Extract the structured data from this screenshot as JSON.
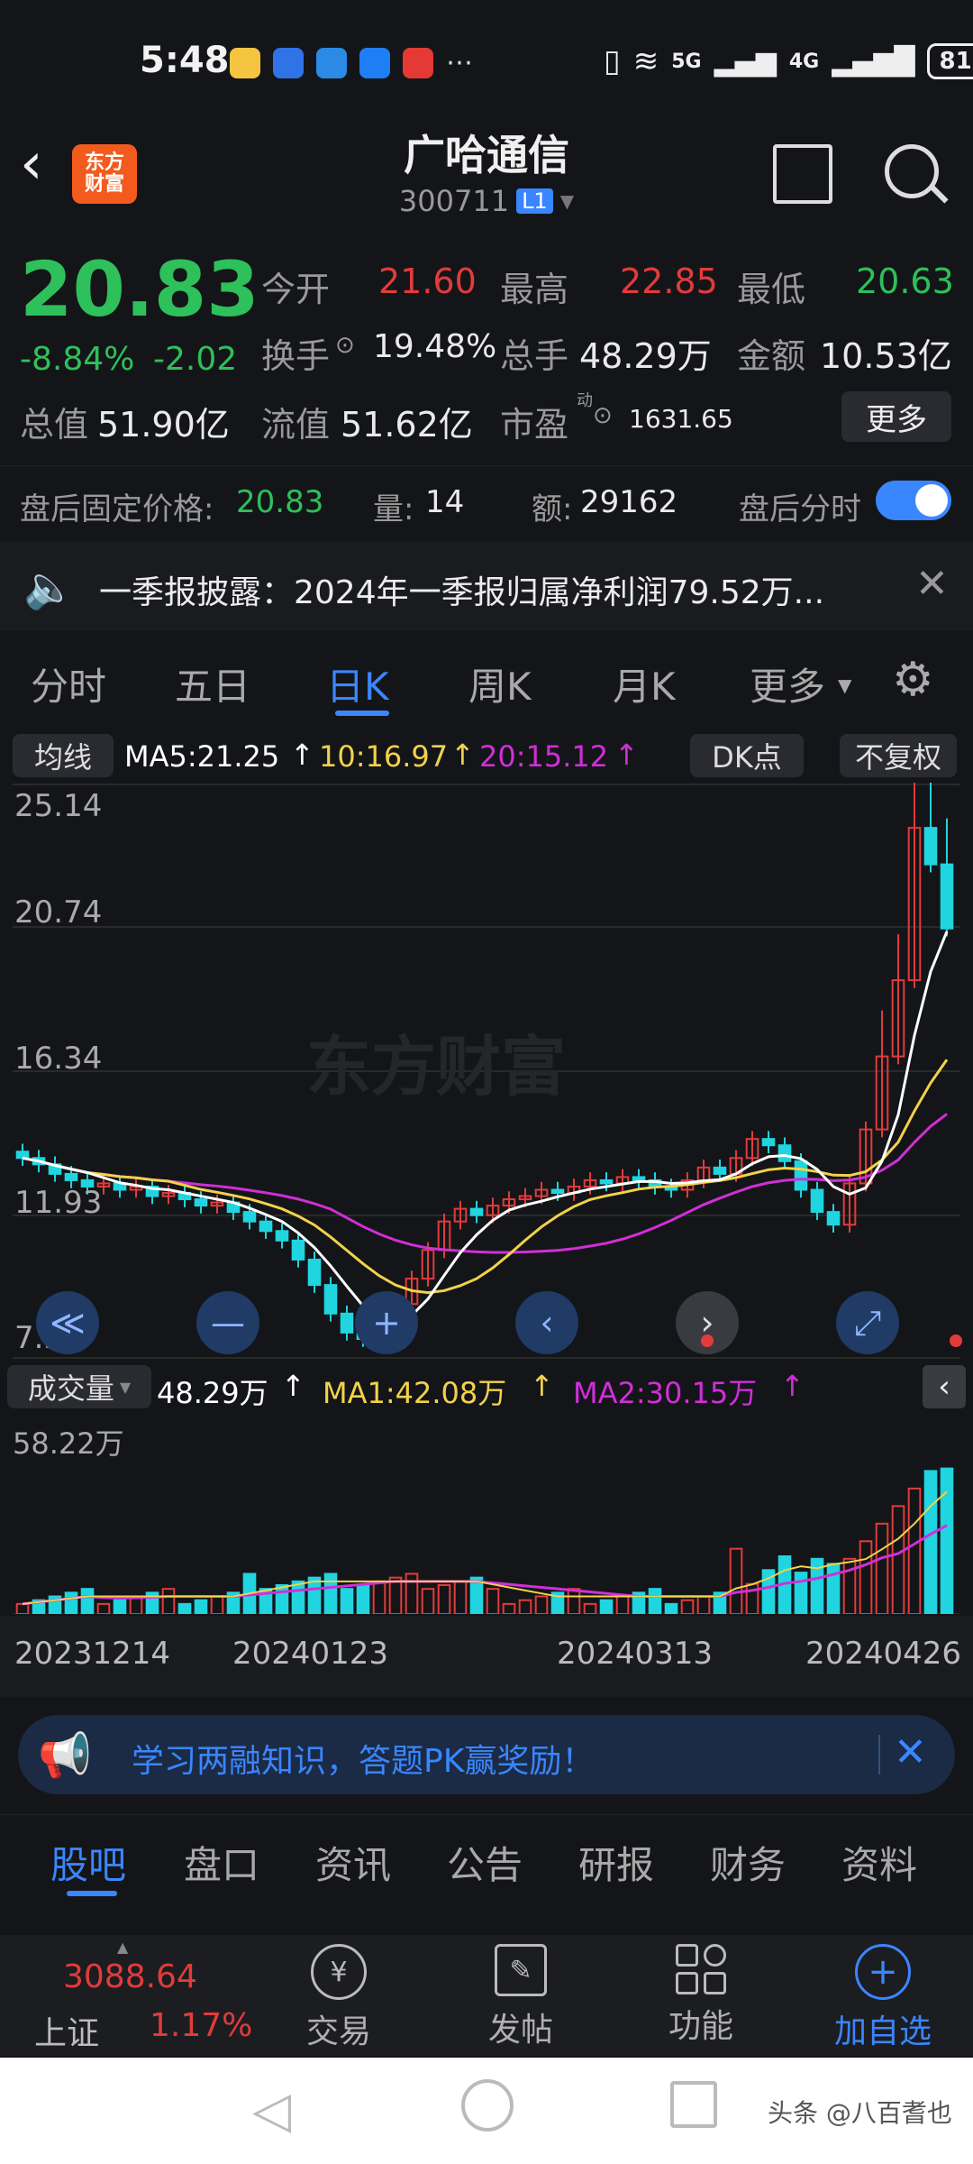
{
  "status": {
    "time": "5:48",
    "icons": [
      "weibo-icon",
      "blue-app-icon",
      "blue-app2-icon",
      "alipay-icon",
      "red-app-icon",
      "more-dots-icon"
    ],
    "signal_text": "5G",
    "signal_text2": "4G",
    "battery": "81"
  },
  "header": {
    "logo_text_line1": "东方",
    "logo_text_line2": "财富",
    "stock_name": "广哈通信",
    "stock_code": "300711",
    "level_badge": "L1"
  },
  "quote": {
    "price": "20.83",
    "pct": "-8.84%",
    "chg": "-2.02",
    "open_label": "今开",
    "open": "21.60",
    "high_label": "最高",
    "high": "22.85",
    "low_label": "最低",
    "low": "20.63",
    "turnover_label": "换手",
    "turnover": "19.48%",
    "volume_label": "总手",
    "volume": "48.29万",
    "amount_label": "金额",
    "amount": "10.53亿",
    "mkt_cap_label": "总值",
    "mkt_cap": "51.90亿",
    "float_cap_label": "流值",
    "float_cap": "51.62亿",
    "pe_label": "市盈",
    "pe_sup": "动",
    "pe": "1631.65",
    "more_label": "更多"
  },
  "afterhours": {
    "price_label": "盘后固定价格:",
    "price": "20.83",
    "vol_label": "量:",
    "vol": "14",
    "amt_label": "额:",
    "amt": "29162",
    "toggle_label": "盘后分时"
  },
  "notice": {
    "text": "一季报披露：2024年一季报归属净利润79.52万..."
  },
  "chart_tabs": [
    "分时",
    "五日",
    "日K",
    "周K",
    "月K",
    "更多"
  ],
  "chart_tabs_active": 2,
  "ma_bar": {
    "label": "均线",
    "ma5": "MA5:21.25",
    "ma10": "10:16.97",
    "ma20": "20:15.12",
    "dk_label": "DK点",
    "adjust_label": "不复权"
  },
  "price_axis": [
    "25.14",
    "20.74",
    "16.34",
    "11.93",
    "7.53"
  ],
  "watermark": "东方财富",
  "volume_bar": {
    "label": "成交量",
    "vol": "48.29万",
    "ma1": "MA1:42.08万",
    "ma2": "MA2:30.15万",
    "max": "58.22万"
  },
  "dates": [
    "20231214",
    "20240123",
    "20240313",
    "20240426"
  ],
  "promo": {
    "text": "学习两融知识，答题PK赢奖励！"
  },
  "section_tabs": [
    "股吧",
    "盘口",
    "资讯",
    "公告",
    "研报",
    "财务",
    "资料"
  ],
  "section_tabs_active": 0,
  "bottom_nav": {
    "index_value": "3088.64",
    "index_name": "上证",
    "index_pct": "1.17%",
    "items": [
      "交易",
      "发帖",
      "功能",
      "加自选"
    ]
  },
  "watermark_footer": "头条 @八百耆也",
  "colors": {
    "up": "#e23b3b",
    "down": "#2ec05a",
    "accent": "#3a86ff",
    "ma5": "#ffffff",
    "ma10": "#f2d24b",
    "ma20": "#d02fd8",
    "vol_up": "#e23b3b",
    "vol_down": "#20d4e0"
  },
  "chart_data": {
    "type": "candlestick",
    "price_range": [
      7.53,
      25.14
    ],
    "x": [
      "20231214",
      "20240123",
      "20240313",
      "20240426"
    ],
    "closes_approx": [
      13.6,
      13.4,
      13.1,
      12.9,
      12.7,
      12.8,
      12.6,
      12.7,
      12.4,
      12.5,
      12.3,
      12.1,
      12.2,
      11.9,
      11.6,
      11.3,
      11.0,
      10.4,
      9.6,
      8.7,
      8.1,
      7.9,
      8.4,
      9.0,
      9.8,
      10.7,
      11.6,
      12.0,
      11.8,
      12.1,
      12.3,
      12.4,
      12.6,
      12.5,
      12.7,
      12.9,
      12.8,
      13.0,
      12.9,
      12.7,
      12.6,
      12.9,
      13.3,
      13.1,
      13.6,
      14.2,
      14.0,
      13.5,
      12.6,
      11.9,
      11.5,
      12.8,
      14.5,
      16.8,
      19.2,
      24.0,
      22.85,
      20.83
    ]
  }
}
